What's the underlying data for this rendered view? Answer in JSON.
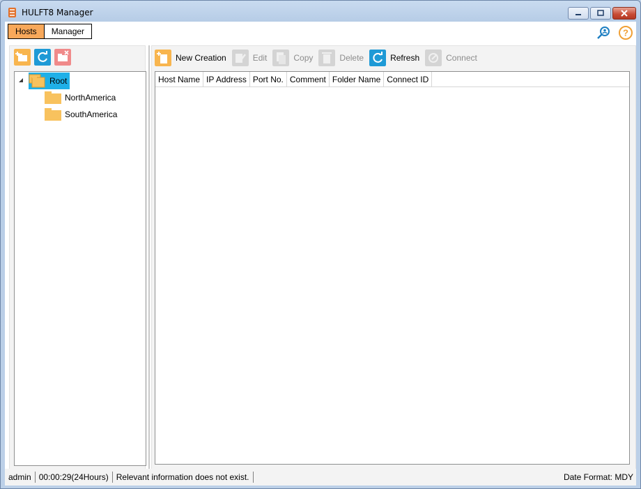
{
  "window": {
    "title": "HULFT8 Manager"
  },
  "tabs": [
    {
      "label": "Hosts",
      "active": true
    },
    {
      "label": "Manager",
      "active": false
    }
  ],
  "top_icons": [
    "search-user-icon",
    "help-icon"
  ],
  "left_toolbar": [
    "new-folder-icon",
    "refresh-icon",
    "delete-folder-icon"
  ],
  "tree": {
    "root": {
      "label": "Root",
      "selected": true
    },
    "children": [
      {
        "label": "NorthAmerica"
      },
      {
        "label": "SouthAmerica"
      }
    ]
  },
  "toolbar": {
    "new_creation": "New Creation",
    "edit": "Edit",
    "copy": "Copy",
    "delete": "Delete",
    "refresh": "Refresh",
    "connect": "Connect"
  },
  "grid": {
    "columns": [
      "Host Name",
      "IP Address",
      "Port No.",
      "Comment",
      "Folder Name",
      "Connect ID"
    ]
  },
  "status": {
    "user": "admin",
    "time": "00:00:29(24Hours)",
    "message": "Relevant information does not exist.",
    "date_format": "Date Format: MDY"
  },
  "colors": {
    "accent": "#f8a85a",
    "selection": "#1fb0e8",
    "refresh": "#1e9ad6"
  }
}
